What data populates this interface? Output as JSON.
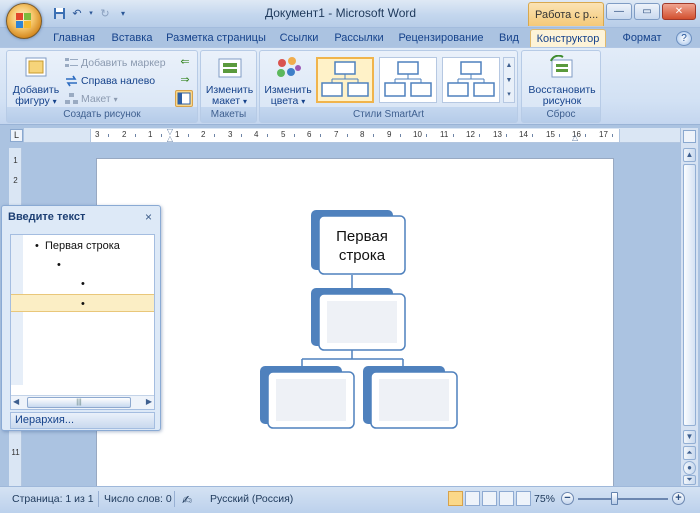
{
  "window": {
    "title": "Документ1 - Microsoft Word",
    "context_tab_title": "Работа с р..."
  },
  "tabs": [
    {
      "label": "Главная"
    },
    {
      "label": "Вставка"
    },
    {
      "label": "Разметка страницы"
    },
    {
      "label": "Ссылки"
    },
    {
      "label": "Рассылки"
    },
    {
      "label": "Рецензирование"
    },
    {
      "label": "Вид"
    },
    {
      "label": "Конструктор",
      "active": true
    },
    {
      "label": "Формат"
    }
  ],
  "ribbon": {
    "create_graphic": {
      "label": "Создать рисунок",
      "add_shape_line1": "Добавить",
      "add_shape_line2": "фигуру",
      "add_bullet": "Добавить маркер",
      "right_to_left": "Справа налево",
      "layout_btn": "Макет"
    },
    "layouts": {
      "label": "Макеты",
      "change_layout_line1": "Изменить",
      "change_layout_line2": "макет"
    },
    "styles": {
      "label": "Стили SmartArt",
      "change_colors_line1": "Изменить",
      "change_colors_line2": "цвета"
    },
    "reset": {
      "label": "Сброс",
      "reset_line1": "Восстановить",
      "reset_line2": "рисунок"
    }
  },
  "ruler": {
    "corner": "L",
    "ticks": [
      "3",
      "2",
      "1",
      "1",
      "2",
      "3",
      "4",
      "5",
      "6",
      "7",
      "8",
      "9",
      "10",
      "11",
      "12",
      "13",
      "14",
      "15",
      "16",
      "17"
    ],
    "vticks": [
      "1",
      "2",
      "11"
    ]
  },
  "text_pane": {
    "title": "Введите текст",
    "close": "×",
    "rows": [
      {
        "text": "Первая строка",
        "level": 1
      },
      {
        "text": "",
        "level": 2
      },
      {
        "text": "",
        "level": 3
      },
      {
        "text": "",
        "level": 3,
        "selected": true
      }
    ],
    "footer": "Иерархия..."
  },
  "smartart": {
    "top_text": "Первая строка",
    "top_line1": "Первая",
    "top_line2": "строка"
  },
  "status": {
    "page": "Страница: 1 из 1",
    "words": "Число слов: 0",
    "language": "Русский (Россия)",
    "zoom": "75%",
    "zoom_level": 0.5
  },
  "colors": {
    "accent": "#4f81bd",
    "shape_fill_back": "#4f81bd",
    "shape_border": "#4f81bd"
  }
}
